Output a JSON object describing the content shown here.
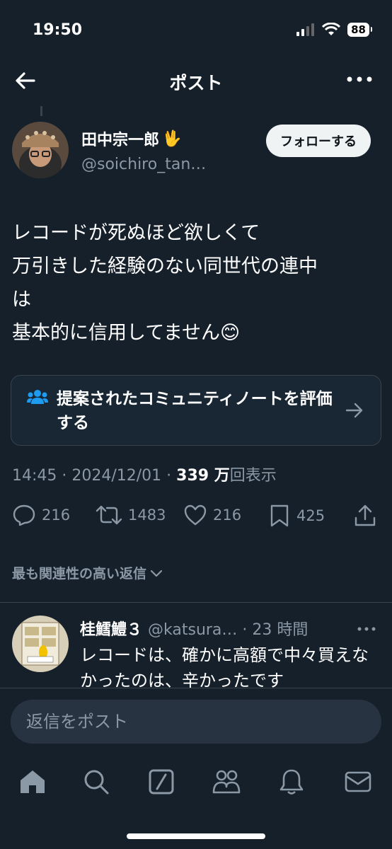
{
  "status": {
    "time": "19:50",
    "battery": "88"
  },
  "nav": {
    "title": "ポスト"
  },
  "tweet": {
    "author_name": "田中宗一郎",
    "author_emoji": "🖖",
    "handle": "@soichiro_tan…",
    "follow_label": "フォローする",
    "lines": [
      "レコードが死ぬほど欲しくて",
      "万引きした経験のない同世代の連中",
      "は",
      "基本的に信用してません😊"
    ],
    "community_note": "提案されたコミュニティノートを評価する",
    "timestamp": "14:45 · 2024/12/01 · ",
    "views_count": "339 万",
    "views_label": "回表示",
    "replies": "216",
    "retweets": "1483",
    "likes": "216",
    "bookmarks": "425"
  },
  "sort_label": "最も関連性の高い返信",
  "reply": {
    "name": "桂鱈鱧３",
    "handle": "@katsura… · 23 時間",
    "text": "レコードは、確かに高額で中々買えなかったのは、辛かったです"
  },
  "compose": {
    "placeholder": "返信をポスト"
  },
  "tabs": [
    "home-icon",
    "search-icon",
    "grok-icon",
    "communities-icon",
    "notifications-icon",
    "messages-icon"
  ],
  "colors": {
    "background": "#15202b",
    "accent": "#1d9bf0",
    "muted": "#8b98a5"
  }
}
